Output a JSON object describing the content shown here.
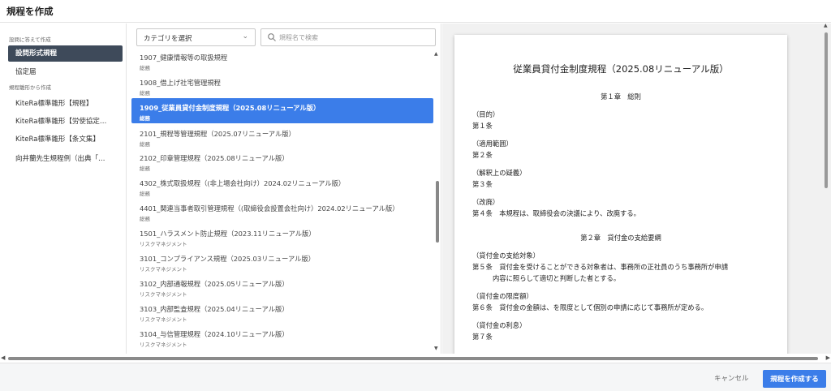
{
  "header": {
    "title": "規程を作成"
  },
  "sidebar": {
    "section1": "設問に答えて作成",
    "section2": "規程雛形から作成",
    "items": [
      {
        "label": "設問形式規程"
      },
      {
        "label": "協定届"
      },
      {
        "label": "KiteRa標準雛形【規程】"
      },
      {
        "label": "KiteRa標準雛形【労使協定…"
      },
      {
        "label": "KiteRa標準雛形【条文集】"
      },
      {
        "label": "向井蘭先生規程例（出典「…"
      }
    ]
  },
  "filters": {
    "category_select": "カテゴリを選択",
    "search_placeholder": "規程名で検索"
  },
  "list": [
    {
      "title": "1907_健康情報等の取扱規程",
      "category": "総務"
    },
    {
      "title": "1908_借上げ社宅管理規程",
      "category": "総務"
    },
    {
      "title": "1909_従業員貸付金制度規程（2025.08リニューアル版）",
      "category": "総務"
    },
    {
      "title": "2101_規程等管理規程（2025.07リニューアル版）",
      "category": "総務"
    },
    {
      "title": "2102_印章管理規程（2025.08リニューアル版）",
      "category": "総務"
    },
    {
      "title": "4302_株式取扱規程（(非上場会社向け）2024.02リニューアル版）",
      "category": "総務"
    },
    {
      "title": "4401_関連当事者取引管理規程（(取締役会設置会社向け）2024.02リニューアル版）",
      "category": "総務"
    },
    {
      "title": "1501_ハラスメント防止規程（2023.11リニューアル版）",
      "category": "リスクマネジメント"
    },
    {
      "title": "3101_コンプライアンス規程（2025.03リニューアル版）",
      "category": "リスクマネジメント"
    },
    {
      "title": "3102_内部通報規程（2025.05リニューアル版）",
      "category": "リスクマネジメント"
    },
    {
      "title": "3103_内部監査規程（2025.04リニューアル版）",
      "category": "リスクマネジメント"
    },
    {
      "title": "3104_与信管理規程（2024.10リニューアル版）",
      "category": "リスクマネジメント"
    }
  ],
  "document": {
    "title": "従業員貸付金制度規程（2025.08リニューアル版）",
    "chapter1": "第１章　総則",
    "h1": "（目的）",
    "a1": "第１条",
    "h2": "（適用範囲）",
    "a2": "第２条",
    "h3": "（解釈上の疑義）",
    "a3": "第３条",
    "h4": "（改廃）",
    "a4": "第４条　本規程は、取締役会の決議により、改廃する。",
    "chapter2": "第２章　貸付金の支給要綱",
    "h5": "（貸付金の支給対象）",
    "a5": "第５条　貸付金を受けることができる対象者は、事務所の正社員のうち事務所が申請",
    "a5b": "内容に照らして適切と判断した者とする。",
    "h6": "（貸付金の限度額）",
    "a6": "第６条　貸付金の金額は、を限度として個別の申請に応じて事務所が定める。",
    "h7": "（貸付金の利息）",
    "a7": "第７条"
  },
  "footer": {
    "cancel": "キャンセル",
    "create": "規程を作成する"
  }
}
